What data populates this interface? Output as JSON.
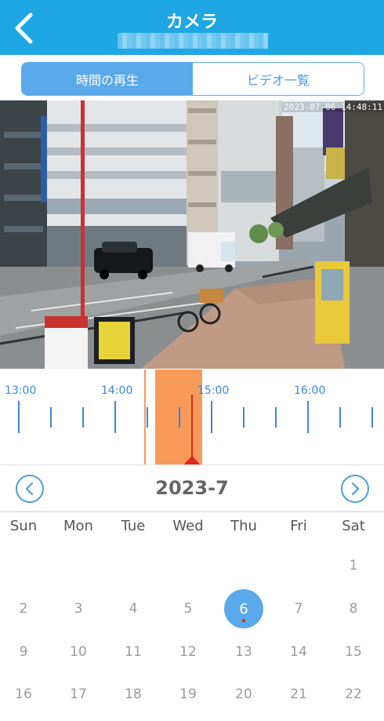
{
  "header": {
    "title": "カメラ",
    "back_icon": "chevron-left-icon"
  },
  "tabs": [
    {
      "label": "時間の再生",
      "active": true
    },
    {
      "label": "ビデオ一覧",
      "active": false
    }
  ],
  "video": {
    "timestamp": "2023-07-06 14:48:11"
  },
  "timeline": {
    "labels": [
      "13:00",
      "14:00",
      "15:00",
      "16:00"
    ],
    "cursor_time": "14:48"
  },
  "calendar": {
    "month_title": "2023-7",
    "prev_icon": "chevron-left-circle-icon",
    "next_icon": "chevron-right-circle-icon",
    "weekdays": [
      "Sun",
      "Mon",
      "Tue",
      "Wed",
      "Thu",
      "Fri",
      "Sat"
    ],
    "days": [
      "1",
      "2",
      "3",
      "4",
      "5",
      "6",
      "7",
      "8",
      "9",
      "10",
      "11",
      "12",
      "13",
      "14",
      "15",
      "16",
      "17",
      "18",
      "19",
      "20",
      "21",
      "22"
    ],
    "selected_day": "6"
  },
  "colors": {
    "header_bg": "#1ea7e4",
    "accent": "#5aa9ea",
    "range": "#f79a5a",
    "cursor": "#e1261c"
  }
}
